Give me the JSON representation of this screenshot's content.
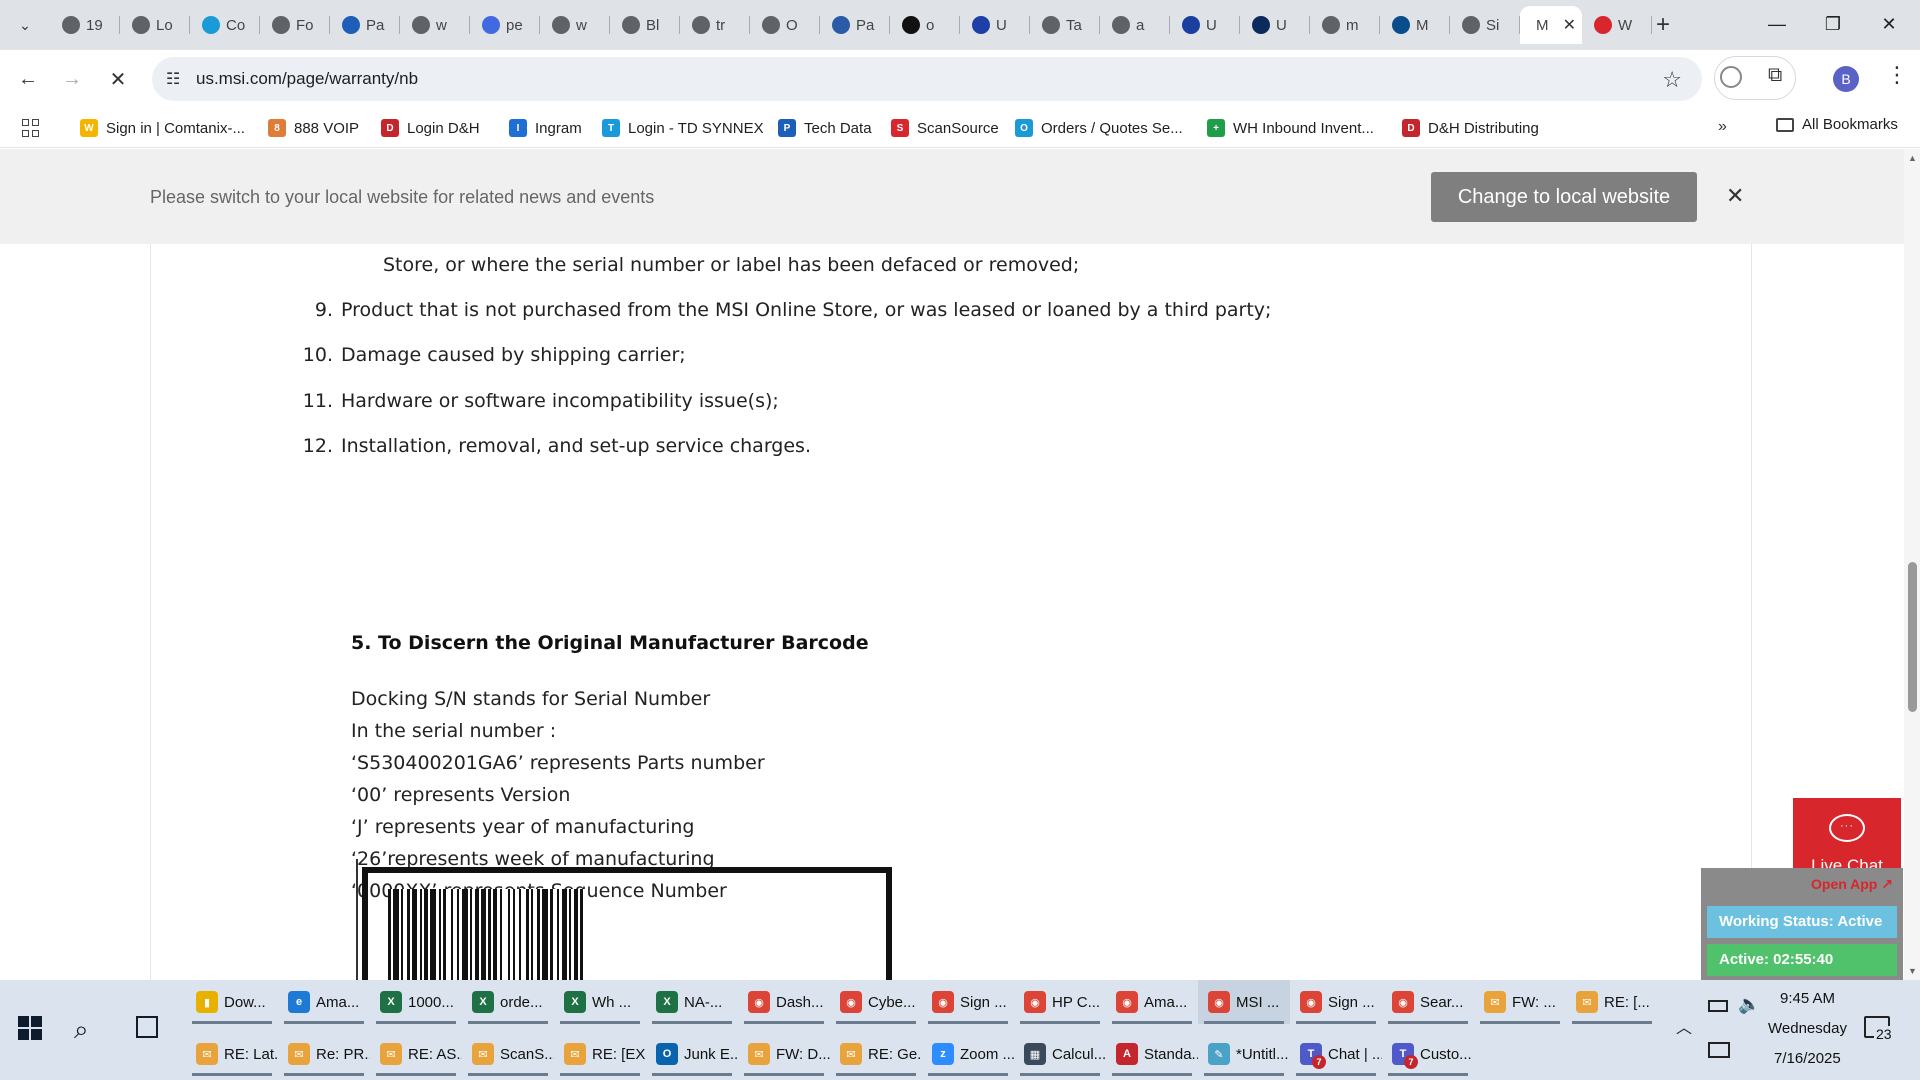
{
  "browser": {
    "tabs": [
      {
        "title": "19",
        "icon": "globe"
      },
      {
        "title": "Lo",
        "icon": "globe"
      },
      {
        "title": "Co",
        "icon": "logo-square"
      },
      {
        "title": "Fo",
        "icon": "globe"
      },
      {
        "title": "Pa",
        "icon": "arrow-chevron"
      },
      {
        "title": "w",
        "icon": "globe"
      },
      {
        "title": "pe",
        "icon": "pe-logo"
      },
      {
        "title": "w",
        "icon": "globe"
      },
      {
        "title": "Bl",
        "icon": "globe"
      },
      {
        "title": "tr",
        "icon": "globe"
      },
      {
        "title": "O",
        "icon": "globe"
      },
      {
        "title": "Pa",
        "icon": "cloud"
      },
      {
        "title": "o",
        "icon": "black-circle"
      },
      {
        "title": "U",
        "icon": "u-logo"
      },
      {
        "title": "Ta",
        "icon": "globe"
      },
      {
        "title": "a",
        "icon": "globe"
      },
      {
        "title": "U",
        "icon": "blue-square"
      },
      {
        "title": "U",
        "icon": "check-logo"
      },
      {
        "title": "m",
        "icon": "globe"
      },
      {
        "title": "M",
        "icon": "etn-logo"
      },
      {
        "title": "Si",
        "icon": "globe"
      },
      {
        "title": "M",
        "icon": "msi",
        "active": true
      },
      {
        "title": "W",
        "icon": "shield-red"
      }
    ],
    "url": "us.msi.com/page/warranty/nb",
    "profile_initial": "B",
    "bookmarks": [
      {
        "label": "Sign in | Comtanix-...",
        "color": "#f5b400",
        "glyph": "W"
      },
      {
        "label": "888 VOIP",
        "color": "#e07b39",
        "glyph": "8"
      },
      {
        "label": "Login D&H",
        "color": "#c4262e",
        "glyph": "D"
      },
      {
        "label": "Ingram",
        "color": "#1f6ed4",
        "glyph": "I"
      },
      {
        "label": "Login - TD SYNNEX",
        "color": "#1a9bd7",
        "glyph": "T"
      },
      {
        "label": "Tech Data",
        "color": "#1d5fb8",
        "glyph": "P"
      },
      {
        "label": "ScanSource",
        "color": "#d8262d",
        "glyph": "S"
      },
      {
        "label": "Orders / Quotes Se...",
        "color": "#1a9bd7",
        "glyph": "O"
      },
      {
        "label": "WH Inbound Invent...",
        "color": "#1e9e49",
        "glyph": "+"
      },
      {
        "label": "D&H Distributing",
        "color": "#c4262e",
        "glyph": "D"
      }
    ],
    "all_bookmarks": "All Bookmarks"
  },
  "page": {
    "banner_text": "Please switch to your local website for related news and events",
    "banner_button": "Change to local website",
    "list_partial": "Store, or where the serial number or label has been defaced or removed;",
    "list_items": [
      {
        "num": "9.",
        "text": "Product that is not purchased from the MSI Online Store, or was leased or loaned by a third party;"
      },
      {
        "num": "10.",
        "text": "Damage caused by shipping carrier;"
      },
      {
        "num": "11.",
        "text": "Hardware or software incompatibility issue(s);"
      },
      {
        "num": "12.",
        "text": "Installation, removal, and set-up service charges."
      }
    ],
    "section_heading": "5. To Discern the Original Manufacturer Barcode",
    "paragraph_lines": [
      "Docking S/N stands for Serial Number",
      "In the serial number :",
      "‘S530400201GA6’ represents Parts number",
      "‘00’ represents Version",
      "‘J’ represents year of manufacturing",
      "‘26’represents week of manufacturing",
      "‘0000XX’ represents Sequence Number"
    ],
    "live_chat_label": "Live Chat",
    "open_app": "Open App ↗",
    "working_status": "Working Status: Active",
    "active_time": "Active: 02:55:40"
  },
  "taskbar": {
    "row1": [
      {
        "label": "Dow...",
        "color": "#e8b100",
        "glyph": "▮"
      },
      {
        "label": "Ama...",
        "color": "#1f7ad6",
        "glyph": "e"
      },
      {
        "label": "1000...",
        "color": "#1e7145",
        "glyph": "X"
      },
      {
        "label": "orde...",
        "color": "#1e7145",
        "glyph": "X"
      },
      {
        "label": "Wh ...",
        "color": "#1e7145",
        "glyph": "X"
      },
      {
        "label": "NA-...",
        "color": "#1e7145",
        "glyph": "X"
      },
      {
        "label": "Dash...",
        "color": "#db4437",
        "glyph": "◉"
      },
      {
        "label": "Cybe...",
        "color": "#db4437",
        "glyph": "◉"
      },
      {
        "label": "Sign ...",
        "color": "#db4437",
        "glyph": "◉"
      },
      {
        "label": "HP C...",
        "color": "#db4437",
        "glyph": "◉"
      },
      {
        "label": "Ama...",
        "color": "#db4437",
        "glyph": "◉"
      },
      {
        "label": "MSI ...",
        "color": "#db4437",
        "glyph": "◉",
        "active": true
      },
      {
        "label": "Sign ...",
        "color": "#db4437",
        "glyph": "◉"
      },
      {
        "label": "Sear...",
        "color": "#db4437",
        "glyph": "◉"
      },
      {
        "label": "FW: ...",
        "color": "#e8a33d",
        "glyph": "✉"
      },
      {
        "label": "RE: [...",
        "color": "#e8a33d",
        "glyph": "✉"
      }
    ],
    "row2": [
      {
        "label": "RE: Lat...",
        "color": "#e8a33d",
        "glyph": "✉"
      },
      {
        "label": "Re: PR...",
        "color": "#e8a33d",
        "glyph": "✉"
      },
      {
        "label": "RE: AS...",
        "color": "#e8a33d",
        "glyph": "✉"
      },
      {
        "label": "ScanS...",
        "color": "#e8a33d",
        "glyph": "✉"
      },
      {
        "label": "RE: [EX...",
        "color": "#e8a33d",
        "glyph": "✉"
      },
      {
        "label": "Junk E...",
        "color": "#0a64ad",
        "glyph": "O"
      },
      {
        "label": "FW: D...",
        "color": "#e8a33d",
        "glyph": "✉"
      },
      {
        "label": "RE: Ge...",
        "color": "#e8a33d",
        "glyph": "✉"
      },
      {
        "label": "Zoom ...",
        "color": "#2d8cff",
        "glyph": "z"
      },
      {
        "label": "Calcul...",
        "color": "#3a4a5c",
        "glyph": "▦"
      },
      {
        "label": "Standa...",
        "color": "#c4262e",
        "glyph": "A"
      },
      {
        "label": "*Untitl...",
        "color": "#4aa3c7",
        "glyph": "✎"
      },
      {
        "label": "Chat | ...",
        "color": "#5059c9",
        "glyph": "T",
        "badge": "7"
      },
      {
        "label": "Custo...",
        "color": "#5059c9",
        "glyph": "T",
        "badge": "7"
      }
    ],
    "time": "9:45 AM",
    "day": "Wednesday",
    "date": "7/16/2025",
    "notifications": "23"
  }
}
